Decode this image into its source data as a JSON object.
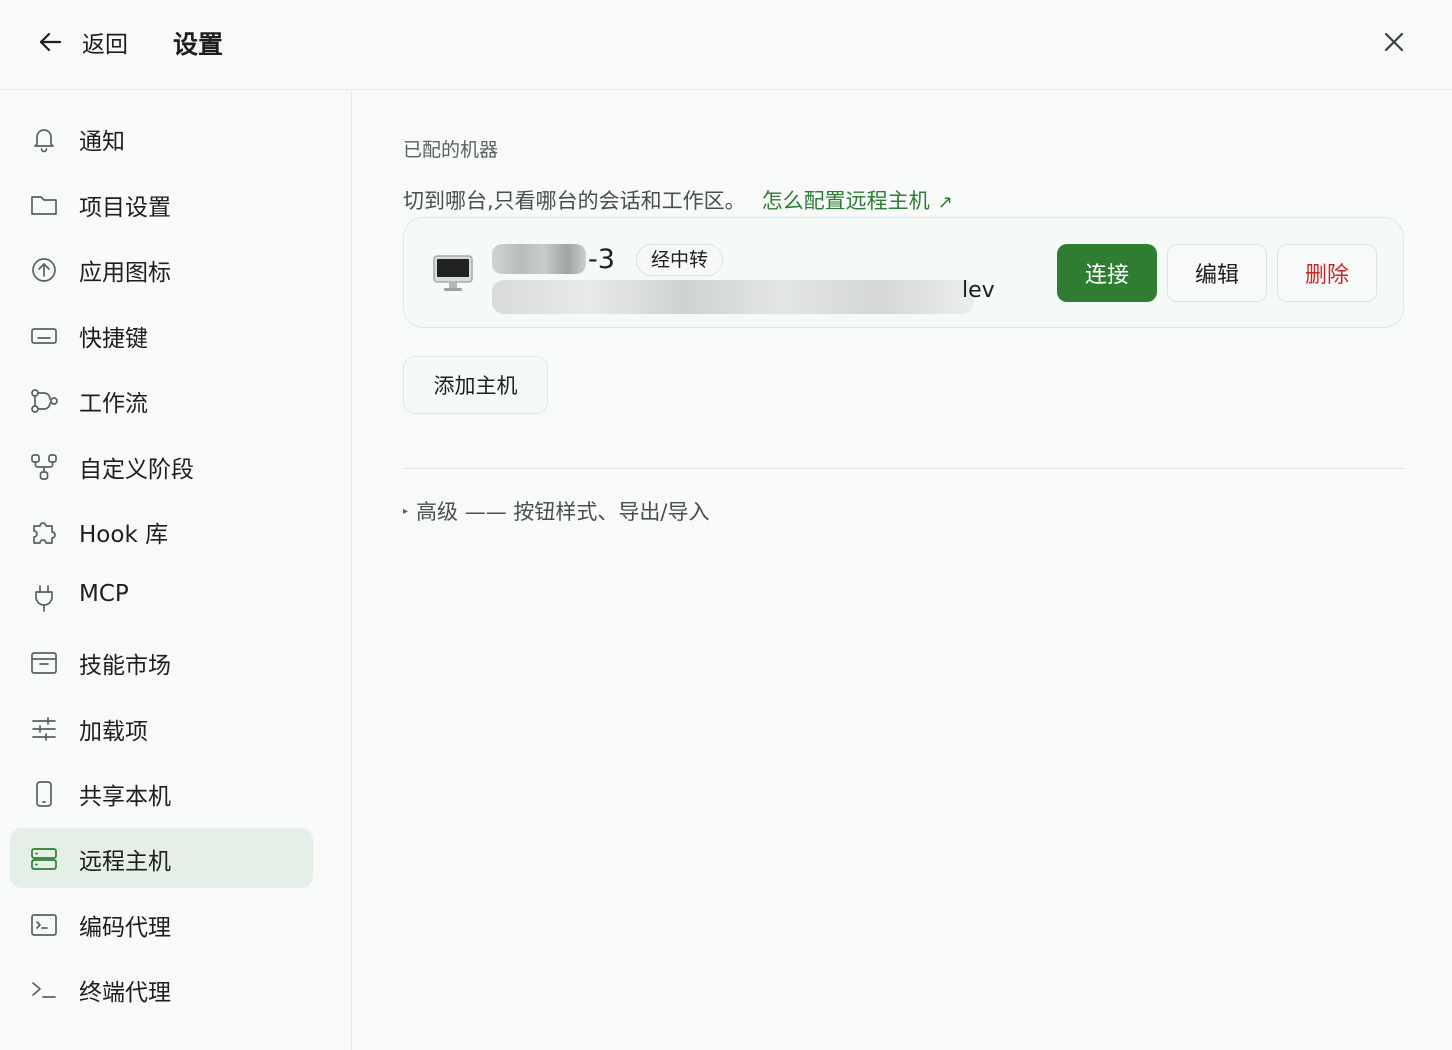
{
  "header": {
    "back_label": "返回",
    "title": "设置"
  },
  "sidebar": {
    "items": [
      {
        "label": "通知",
        "icon": "bell-icon"
      },
      {
        "label": "项目设置",
        "icon": "folder-icon"
      },
      {
        "label": "应用图标",
        "icon": "upload-circle-icon"
      },
      {
        "label": "快捷键",
        "icon": "keyboard-icon"
      },
      {
        "label": "工作流",
        "icon": "workflow-icon"
      },
      {
        "label": "自定义阶段",
        "icon": "branch-icon"
      },
      {
        "label": "Hook 库",
        "icon": "puzzle-icon"
      },
      {
        "label": "MCP",
        "icon": "plug-icon"
      },
      {
        "label": "技能市场",
        "icon": "archive-icon"
      },
      {
        "label": "加载项",
        "icon": "sliders-icon"
      },
      {
        "label": "共享本机",
        "icon": "phone-icon"
      },
      {
        "label": "远程主机",
        "icon": "server-icon",
        "active": true
      },
      {
        "label": "编码代理",
        "icon": "terminal-box-icon"
      },
      {
        "label": "终端代理",
        "icon": "terminal-prompt-icon"
      }
    ]
  },
  "main": {
    "section_title": "已配的机器",
    "description": "切到哪台,只看哪台的会话和工作区。",
    "help_link": "怎么配置远程主机",
    "machine": {
      "name_suffix": "-3",
      "relay_badge": "经中转",
      "address_suffix": "lev",
      "connect_label": "连接",
      "edit_label": "编辑",
      "delete_label": "删除"
    },
    "add_host_label": "添加主机",
    "advanced_label": "高级 —— 按钮样式、导出/导入"
  },
  "colors": {
    "accent": "#2e7d32",
    "danger": "#c62828",
    "active_bg": "#e5efe7"
  }
}
